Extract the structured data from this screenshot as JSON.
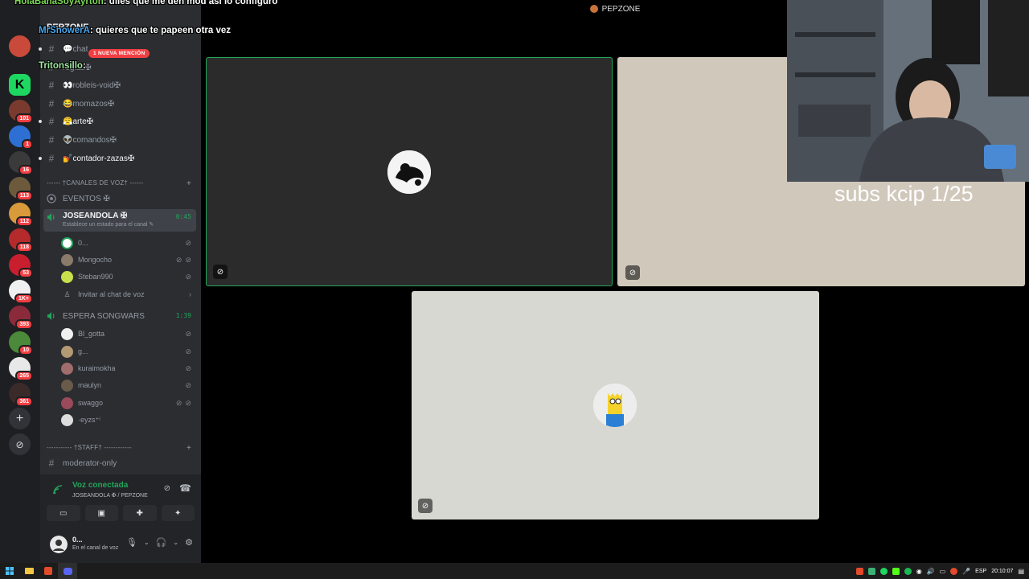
{
  "topbar": {
    "server_title": "PEPZONE"
  },
  "chat_overlay": [
    {
      "user": "HolaBanaSoyAyrton",
      "message": "diles que me den mod asi lo configuro"
    },
    {
      "user": "MrSnowerA",
      "message": "quieres que te papeen otra vez"
    },
    {
      "user": "Tritonsillo",
      "message": ""
    }
  ],
  "server_rail": {
    "badges": [
      "101",
      "1",
      "16",
      "113",
      "112",
      "118",
      "53",
      "1K+",
      "393",
      "10",
      "265",
      "361"
    ],
    "add_server_icon": "plus-icon",
    "explore_icon": "compass-icon"
  },
  "sidebar": {
    "server_name": "PEPZONE",
    "mention_pill": "1 NUEVA MENCIÓN",
    "text_channels": [
      {
        "name": "💬chat",
        "unread": true
      },
      {
        "name": "reglas✠",
        "unread": false
      },
      {
        "name": "👀robleis-void✠",
        "unread": false
      },
      {
        "name": "😂momazos✠",
        "unread": false
      },
      {
        "name": "😤arte✠",
        "unread": true
      },
      {
        "name": "👽comandos✠",
        "unread": false
      },
      {
        "name": "💅contador-zazas✠",
        "unread": true
      }
    ],
    "voice_category": "------ †CANALES DE VOZ† ------",
    "events_label": "EVENTOS ✠",
    "active_voice": {
      "name": "JOSEANDOLA ✠",
      "timer": "0:45",
      "status_hint": "Establece un estado para el canal ✎",
      "members": [
        {
          "name": "0...",
          "color": "#ffffff"
        },
        {
          "name": "Mongocho",
          "color": "#8b7b6a"
        },
        {
          "name": "Steban990",
          "color": "#c9e04a"
        }
      ],
      "invite_label": "Invitar al chat de voz"
    },
    "second_voice": {
      "name": "ESPERA SONGWARS",
      "timer": "1:39",
      "members": [
        {
          "name": "Bl_gotta",
          "color": "#f0f0f0"
        },
        {
          "name": "g...",
          "color": "#b49a72"
        },
        {
          "name": "kuraimokha",
          "color": "#a06c6c"
        },
        {
          "name": "maulyn",
          "color": "#6a5a4a"
        },
        {
          "name": "swaggo",
          "color": "#9a4a5a"
        },
        {
          "name": "·eyzs⁺ⁱ",
          "color": "#ddd"
        }
      ]
    },
    "staff_category": "----------- †STAFF† ------------",
    "staff_channel": "moderator-only"
  },
  "voice_panel": {
    "status": "Voz conectada",
    "location": "JOSEANDOLA ✠ / PEPZONE"
  },
  "user_bar": {
    "name": "0...",
    "status": "En el canal de voz"
  },
  "overlay": {
    "subs_text": "subs kcip 1/25"
  },
  "taskbar": {
    "lang": "ESP",
    "time": "20:10:07"
  },
  "colors": {
    "accent_green": "#23a55a",
    "badge_red": "#f23f43",
    "chat_user_green": "#7ed957"
  }
}
